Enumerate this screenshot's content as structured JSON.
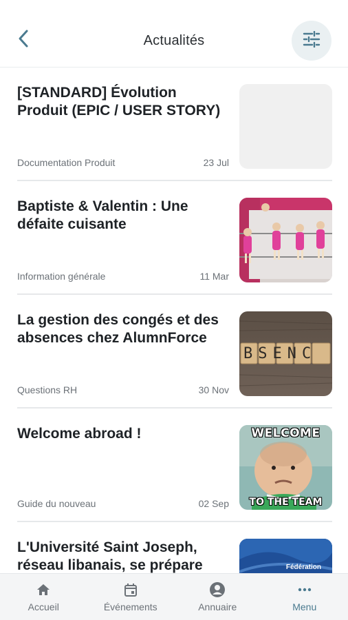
{
  "header": {
    "title": "Actualités"
  },
  "icons": {
    "back": "chevron-left-icon",
    "filter": "sliders-icon"
  },
  "colors": {
    "accent": "#4a7a8f",
    "filter_bg": "#eaf0f2",
    "muted_text": "#6b7177",
    "divider": "#e6e8ea"
  },
  "news": [
    {
      "title": "[STANDARD] Évolution Produit (EPIC / USER STORY)",
      "category": "Documentation Produit",
      "date": "23 Jul",
      "thumbnail": "placeholder"
    },
    {
      "title": "Baptiste & Valentin : Une défaite cuisante",
      "category": "Information générale",
      "date": "11 Mar",
      "thumbnail": "foosball-table"
    },
    {
      "title": "La gestion des congés et des absences chez AlumnForce",
      "category": "Questions RH",
      "date": "30 Nov",
      "thumbnail": "wooden-letter-blocks",
      "thumbnail_text": "BSENC"
    },
    {
      "title": "Welcome abroad !",
      "category": "Guide du nouveau",
      "date": "02 Sep",
      "thumbnail": "baby-meme",
      "thumbnail_top_text": "WELCOME",
      "thumbnail_bottom_text": "TO THE TEAM"
    },
    {
      "title": "L'Université Saint Joseph, réseau libanais, se prépare",
      "category": "",
      "date": "",
      "thumbnail": "federation-blue",
      "thumbnail_text": "Fédération"
    }
  ],
  "nav": [
    {
      "label": "Accueil",
      "icon": "home-icon",
      "active": false
    },
    {
      "label": "Événements",
      "icon": "calendar-icon",
      "active": false
    },
    {
      "label": "Annuaire",
      "icon": "user-circle-icon",
      "active": false
    },
    {
      "label": "Menu",
      "icon": "more-dots-icon",
      "active": true
    }
  ]
}
